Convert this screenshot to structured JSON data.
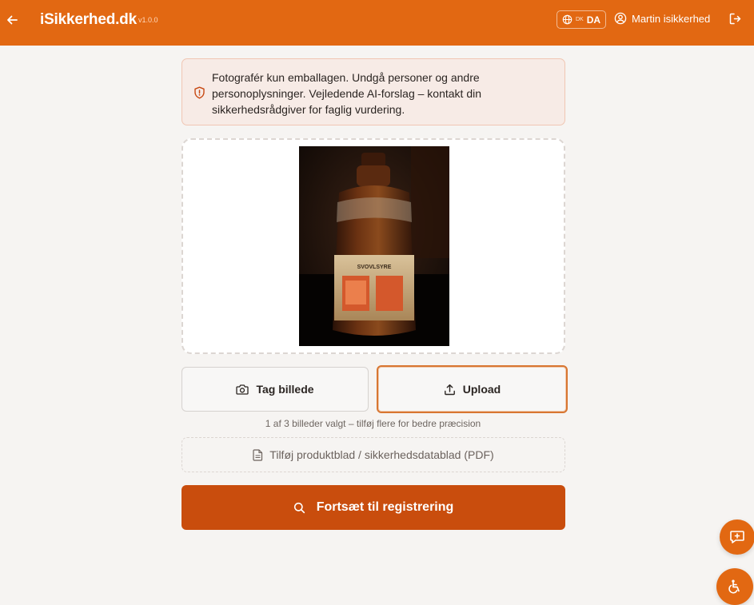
{
  "header": {
    "brand": "iSikkerhed.dk",
    "version": "v1.0.0",
    "language_code": "DK",
    "language_label": "DA",
    "user_name": "Martin isikkerhed"
  },
  "alert": {
    "text": "Fotografér kun emballagen. Undgå personer og andre personoplysninger. Vejledende AI-forslag – kontakt din sikkerhedsrådgiver for faglig vurdering."
  },
  "photo": {
    "label_text": "SVOVLSYRE"
  },
  "actions": {
    "camera_label": "Tag billede",
    "upload_label": "Upload",
    "hint": "1 af 3 billeder valgt – tilføj flere for bedre præcision",
    "pdf_label": "Tilføj produktblad / sikkerhedsdatablad (PDF)",
    "continue_label": "Fortsæt til registrering"
  },
  "colors": {
    "brand": "#e26812",
    "primary": "#c94d0d",
    "alert_bg": "#f7ebe6"
  }
}
